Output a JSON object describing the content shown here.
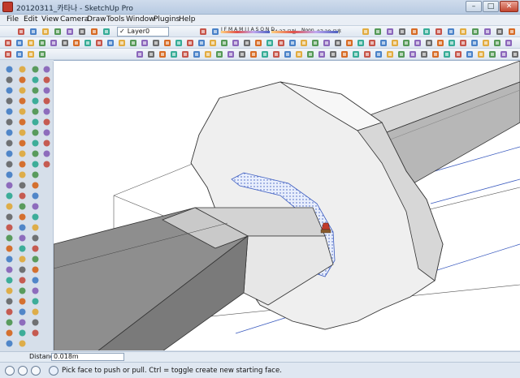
{
  "window": {
    "title": "20120311_카타나 - SketchUp Pro",
    "buttons": {
      "minimize": "–",
      "maximize": "□",
      "close": "✕"
    }
  },
  "menu": [
    "File",
    "Edit",
    "View",
    "Camera",
    "Draw",
    "Tools",
    "Window",
    "Plugins",
    "Help"
  ],
  "layer": {
    "checked": "✓",
    "name": "Layer0"
  },
  "shadow": {
    "months": "J F M A M J J A S O N D",
    "time_start": "04:37 오전",
    "noon": "Noon",
    "time_end": "07:28 오후"
  },
  "vcb": {
    "label": "Distance",
    "value": "0.018m"
  },
  "status": {
    "hint": "Pick face to push or pull.  Ctrl = toggle create new starting face."
  },
  "icons": {
    "app": "sketchup-app-icon",
    "status": [
      "geolocation-icon",
      "credits-icon",
      "user-icon",
      "help-icon"
    ]
  },
  "colors": {
    "titlebar": "#c4d4e8",
    "accent_red": "#c0392b",
    "face_gray": "#bdbdbd",
    "selection_blue": "#3b5bbf"
  }
}
